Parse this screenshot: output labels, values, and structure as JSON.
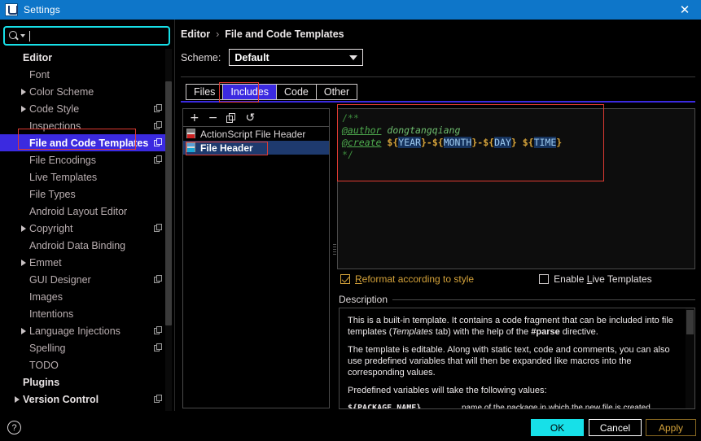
{
  "window": {
    "title": "Settings",
    "icon": "intellij-logo-icon",
    "close_label": "✕"
  },
  "search": {
    "value": "",
    "placeholder": "",
    "icon": "search-icon"
  },
  "sidebar": {
    "items": [
      {
        "label": "Editor",
        "group": true,
        "indent": 0,
        "arrow": false,
        "copy": false,
        "selected": false
      },
      {
        "label": "Font",
        "group": false,
        "indent": 1,
        "arrow": false,
        "copy": false,
        "selected": false
      },
      {
        "label": "Color Scheme",
        "group": false,
        "indent": 1,
        "arrow": true,
        "copy": false,
        "selected": false
      },
      {
        "label": "Code Style",
        "group": false,
        "indent": 1,
        "arrow": true,
        "copy": true,
        "selected": false
      },
      {
        "label": "Inspections",
        "group": false,
        "indent": 1,
        "arrow": false,
        "copy": true,
        "selected": false
      },
      {
        "label": "File and Code Templates",
        "group": false,
        "indent": 1,
        "arrow": false,
        "copy": true,
        "selected": true
      },
      {
        "label": "File Encodings",
        "group": false,
        "indent": 1,
        "arrow": false,
        "copy": true,
        "selected": false
      },
      {
        "label": "Live Templates",
        "group": false,
        "indent": 1,
        "arrow": false,
        "copy": false,
        "selected": false
      },
      {
        "label": "File Types",
        "group": false,
        "indent": 1,
        "arrow": false,
        "copy": false,
        "selected": false
      },
      {
        "label": "Android Layout Editor",
        "group": false,
        "indent": 1,
        "arrow": false,
        "copy": false,
        "selected": false
      },
      {
        "label": "Copyright",
        "group": false,
        "indent": 1,
        "arrow": true,
        "copy": true,
        "selected": false
      },
      {
        "label": "Android Data Binding",
        "group": false,
        "indent": 1,
        "arrow": false,
        "copy": false,
        "selected": false
      },
      {
        "label": "Emmet",
        "group": false,
        "indent": 1,
        "arrow": true,
        "copy": false,
        "selected": false
      },
      {
        "label": "GUI Designer",
        "group": false,
        "indent": 1,
        "arrow": false,
        "copy": true,
        "selected": false
      },
      {
        "label": "Images",
        "group": false,
        "indent": 1,
        "arrow": false,
        "copy": false,
        "selected": false
      },
      {
        "label": "Intentions",
        "group": false,
        "indent": 1,
        "arrow": false,
        "copy": false,
        "selected": false
      },
      {
        "label": "Language Injections",
        "group": false,
        "indent": 1,
        "arrow": true,
        "copy": true,
        "selected": false
      },
      {
        "label": "Spelling",
        "group": false,
        "indent": 1,
        "arrow": false,
        "copy": true,
        "selected": false
      },
      {
        "label": "TODO",
        "group": false,
        "indent": 1,
        "arrow": false,
        "copy": false,
        "selected": false
      },
      {
        "label": "Plugins",
        "group": true,
        "indent": 0,
        "arrow": false,
        "copy": false,
        "selected": false
      },
      {
        "label": "Version Control",
        "group": true,
        "indent": 0,
        "arrow": true,
        "copy": true,
        "selected": false
      }
    ]
  },
  "breadcrumb": {
    "parent": "Editor",
    "separator": "›",
    "current": "File and Code Templates"
  },
  "scheme": {
    "label": "Scheme:",
    "value": "Default",
    "caret_icon": "chevron-down-icon"
  },
  "tabs": [
    {
      "label": "Files",
      "active": false
    },
    {
      "label": "Includes",
      "active": true
    },
    {
      "label": "Code",
      "active": false
    },
    {
      "label": "Other",
      "active": false
    }
  ],
  "list_toolbar": {
    "add": "+",
    "remove": "−",
    "copy": "copy-icon",
    "reset": "↺"
  },
  "template_list": [
    {
      "label": "ActionScript File Header",
      "icon": "actionscript-file-icon",
      "selected": false
    },
    {
      "label": "File Header",
      "icon": "file-header-icon",
      "selected": true
    }
  ],
  "editor": {
    "lines": [
      {
        "type": "comment",
        "text": "/**"
      },
      {
        "type": "author",
        "tag": "@author",
        "value": " dongtangqiang"
      },
      {
        "type": "create",
        "tag": "@create",
        "vars": [
          "${YEAR}",
          "${MONTH}",
          "${DAY}",
          "${TIME}"
        ],
        "sep1": "-",
        "sep2": "-",
        "sep3": " "
      },
      {
        "type": "comment",
        "text": "*/"
      }
    ]
  },
  "options": {
    "reformat": {
      "label": "Reformat according to style",
      "checked": true
    },
    "live_templates": {
      "label": "Enable Live Templates",
      "checked": false
    }
  },
  "description": {
    "legend": "Description",
    "para1_a": "This is a built-in template. It contains a code fragment that can be included into file templates (",
    "para1_i": "Templates",
    "para1_b": " tab) with the help of the ",
    "para1_c": "#parse",
    "para1_d": " directive.",
    "para2": "The template is editable. Along with static text, code and comments, you can also use predefined variables that will then be expanded like macros into the corresponding values.",
    "para3": "Predefined variables will take the following values:",
    "variables": [
      {
        "name": "${PACKAGE_NAME}",
        "desc": "name of the package in which the new file is created"
      }
    ]
  },
  "footer": {
    "help": "?",
    "ok": "OK",
    "cancel": "Cancel",
    "apply": "Apply"
  },
  "colors": {
    "titlebar": "#0e76c9",
    "selection": "#3b2ae0",
    "accent_cyan": "#17e0e8",
    "amber": "#d4a23a",
    "highlight_red": "#e03b32"
  }
}
